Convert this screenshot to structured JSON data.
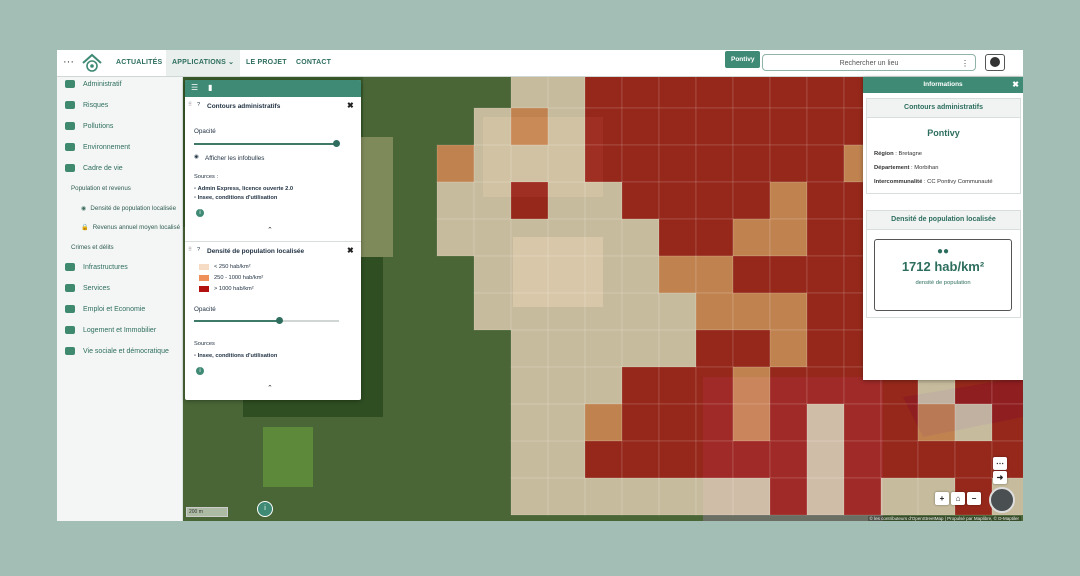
{
  "topbar": {
    "menu_dots": "···",
    "nav": [
      "ACTUALITÉS",
      "APPLICATIONS",
      "LE PROJET",
      "CONTACT"
    ],
    "applications_chevron": "⌄",
    "location_tag": "Pontivy",
    "search_placeholder": "Rechercher un lieu",
    "search_menu": "⋮"
  },
  "sidebar": {
    "items": [
      {
        "label": "Administratif",
        "icon": "map-icon"
      },
      {
        "label": "Risques",
        "icon": "risk-icon"
      },
      {
        "label": "Pollutions",
        "icon": "cloud-icon"
      },
      {
        "label": "Environnement",
        "icon": "leaf-icon"
      },
      {
        "label": "Cadre de vie",
        "icon": "people-icon"
      }
    ],
    "sub_heading": "Population et revenus",
    "sub_items": [
      {
        "label": "Densité de population localisée",
        "mark": "◉"
      },
      {
        "label": "Revenus annuel moyen localisé",
        "mark": "🔒"
      }
    ],
    "sub_heading2": "Crimes et délits",
    "items2": [
      {
        "label": "Infrastructures",
        "icon": "antenna-icon"
      },
      {
        "label": "Services",
        "icon": "basket-icon"
      },
      {
        "label": "Emploi et Economie",
        "icon": "worker-icon"
      },
      {
        "label": "Logement et Immobilier",
        "icon": "building-icon"
      },
      {
        "label": "Vie sociale et démocratique",
        "icon": "vote-icon"
      }
    ]
  },
  "layers": {
    "contours": {
      "title": "Contours administratifs",
      "opacity_label": "Opacité",
      "opacity": 1.0,
      "infobulles_label": "Afficher les infobulles",
      "sources_label": "Sources :",
      "sources": [
        "Admin Express, licence ouverte 2.0",
        "Insee, conditions d'utilisation"
      ]
    },
    "densite": {
      "title": "Densité de population localisée",
      "legend": [
        {
          "label": "< 250 hab/km²",
          "color": "#f6dcc4"
        },
        {
          "label": "250 - 1000 hab/km²",
          "color": "#ef8f5a"
        },
        {
          "label": "> 1000 hab/km²",
          "color": "#b31010"
        }
      ],
      "opacity_label": "Opacité",
      "opacity": 0.59,
      "sources_label": "Sources",
      "sources": [
        "Insee, conditions d'utilisation"
      ]
    }
  },
  "info": {
    "header": "Informations",
    "admin_card": {
      "title": "Contours administratifs",
      "place": "Pontivy",
      "rows": [
        {
          "label": "Région",
          "value": "Bretagne"
        },
        {
          "label": "Département",
          "value": "Morbihan"
        },
        {
          "label": "Intercommunalité",
          "value": "CC Pontivy Communauté"
        }
      ]
    },
    "density_card": {
      "title": "Densité de population localisée",
      "value": "1712 hab/km²",
      "caption": "densité de population"
    }
  },
  "map": {
    "scale": "200 m",
    "attribution": "© les contributeurs d'OpenStreetMap | Propulsé par Maplibre, © D-Maptiler"
  },
  "colors": {
    "accent": "#3e8a74",
    "high": "#b31010",
    "mid": "#ef8f5a",
    "low": "#f6dcc4"
  }
}
